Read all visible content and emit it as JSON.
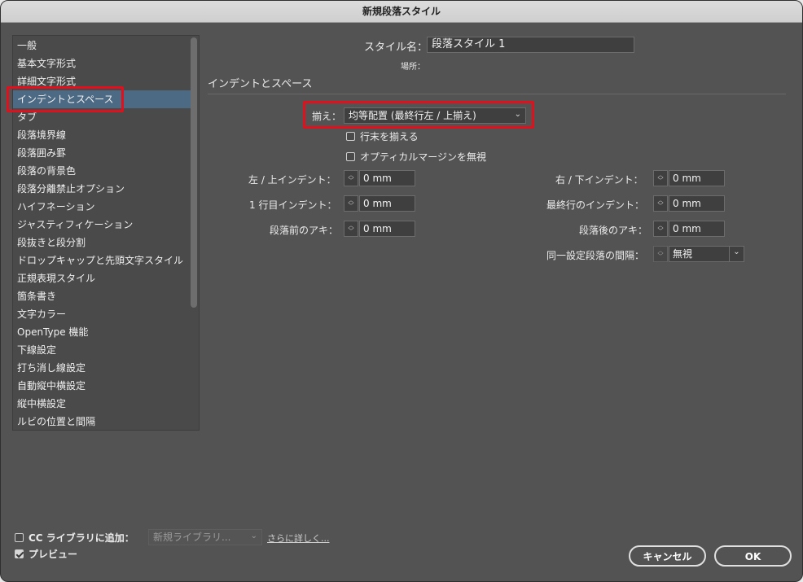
{
  "window": {
    "title": "新規段落スタイル"
  },
  "sidebar": {
    "items": [
      {
        "label": "一般"
      },
      {
        "label": "基本文字形式"
      },
      {
        "label": "詳細文字形式"
      },
      {
        "label": "インデントとスペース"
      },
      {
        "label": "タブ"
      },
      {
        "label": "段落境界線"
      },
      {
        "label": "段落囲み罫"
      },
      {
        "label": "段落の背景色"
      },
      {
        "label": "段落分離禁止オプション"
      },
      {
        "label": "ハイフネーション"
      },
      {
        "label": "ジャスティフィケーション"
      },
      {
        "label": "段抜きと段分割"
      },
      {
        "label": "ドロップキャップと先頭文字スタイル"
      },
      {
        "label": "正規表現スタイル"
      },
      {
        "label": "箇条書き"
      },
      {
        "label": "文字カラー"
      },
      {
        "label": "OpenType 機能"
      },
      {
        "label": "下線設定"
      },
      {
        "label": "打ち消し線設定"
      },
      {
        "label": "自動縦中横設定"
      },
      {
        "label": "縦中横設定"
      },
      {
        "label": "ルビの位置と間隔"
      }
    ],
    "selected_index": 3
  },
  "header": {
    "style_name_label": "スタイル名：",
    "style_name_value": "段落スタイル 1",
    "location_label": "場所："
  },
  "section": {
    "title": "インデントとスペース"
  },
  "align": {
    "label": "揃え：",
    "value": "均等配置 (最終行左 / 上揃え)"
  },
  "checkboxes": {
    "align_line_end": {
      "label": "行末を揃える",
      "checked": false
    },
    "optical_margin": {
      "label": "オプティカルマージンを無視",
      "checked": false
    }
  },
  "indents": {
    "left_top": {
      "label": "左 / 上インデント：",
      "value": "0 mm"
    },
    "first_line": {
      "label": "1 行目インデント：",
      "value": "0 mm"
    },
    "space_before": {
      "label": "段落前のアキ：",
      "value": "0 mm"
    },
    "right_bottom": {
      "label": "右 / 下インデント：",
      "value": "0 mm"
    },
    "last_line": {
      "label": "最終行のインデント：",
      "value": "0 mm"
    },
    "space_after": {
      "label": "段落後のアキ：",
      "value": "0 mm"
    },
    "same_style_spacing": {
      "label": "同一設定段落の間隔：",
      "value": "無視"
    }
  },
  "footer": {
    "cc_library_label": "CC ライブラリに追加：",
    "cc_library_value": "新規ライブラリ...",
    "more_info_link": "さらに詳しく...",
    "preview_label": "プレビュー",
    "preview_checked": true,
    "cancel_label": "キャンセル",
    "ok_label": "OK"
  },
  "colors": {
    "dialog_bg": "#535353",
    "selection": "#4d6a85",
    "highlight": "#e0101d"
  }
}
